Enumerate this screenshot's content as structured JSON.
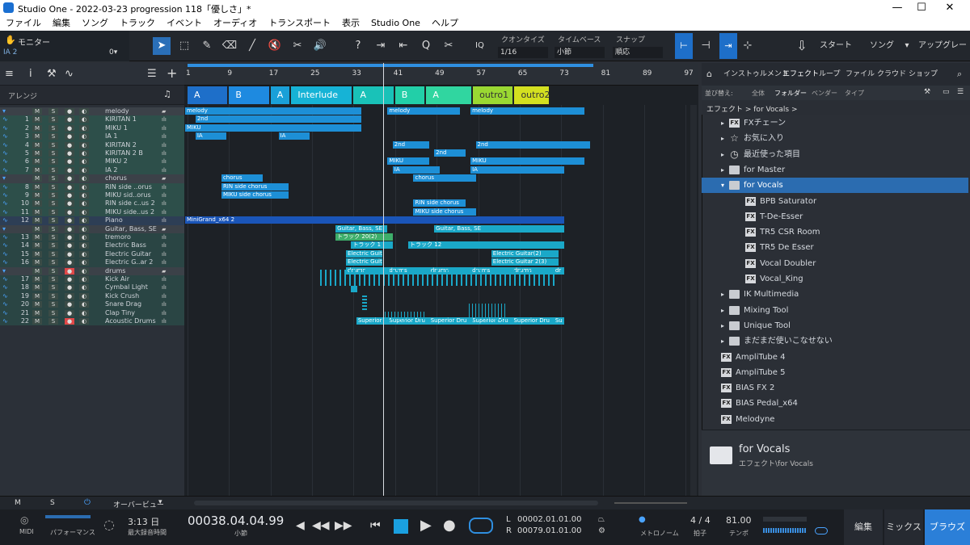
{
  "window": {
    "title": "Studio One - 2022-03-23 progression 118「優しさ」*"
  },
  "menu": [
    "ファイル",
    "編集",
    "ソング",
    "トラック",
    "イベント",
    "オーディオ",
    "トランスポート",
    "表示",
    "Studio One",
    "ヘルプ"
  ],
  "toolbar": {
    "monitor": "モニター",
    "track": "IA 2",
    "track_val": "0▾",
    "iq": "IQ",
    "quantize_label": "クオンタイズ",
    "quantize_val": "1/16",
    "timebase_label": "タイムベース",
    "timebase_val": "小節",
    "snap_label": "スナップ",
    "snap_val": "順応",
    "start": "スタート",
    "song": "ソング",
    "upgrade": "アップグレード"
  },
  "arrange_label": "アレンジ",
  "ruler": [
    "1",
    "9",
    "17",
    "25",
    "33",
    "41",
    "49",
    "57",
    "65",
    "73",
    "81",
    "89",
    "97"
  ],
  "sections": [
    {
      "label": "A",
      "c": "#1e6fc9"
    },
    {
      "label": "B",
      "c": "#1e8ae0"
    },
    {
      "label": "A",
      "c": "#1aa0d8"
    },
    {
      "label": "Interlude",
      "c": "#16b3d6"
    },
    {
      "label": "A",
      "c": "#19c2b8"
    },
    {
      "label": "B",
      "c": "#22cfa8"
    },
    {
      "label": "A",
      "c": "#30d6a0"
    },
    {
      "label": "outro1",
      "c": "#9ad832"
    },
    {
      "label": "outro2",
      "c": "#d4e020"
    }
  ],
  "tracks": [
    {
      "n": "",
      "name": "melody",
      "t": "folder"
    },
    {
      "n": "1",
      "name": "KIRITAN 1",
      "t": "ga"
    },
    {
      "n": "2",
      "name": "MIKU 1",
      "t": "ga"
    },
    {
      "n": "3",
      "name": "IA 1",
      "t": "ga"
    },
    {
      "n": "4",
      "name": "KIRITAN 2",
      "t": "ga"
    },
    {
      "n": "5",
      "name": "KIRITAN 2 B",
      "t": "ga"
    },
    {
      "n": "6",
      "name": "MIKU 2",
      "t": "ga"
    },
    {
      "n": "7",
      "name": "IA 2",
      "t": "ga"
    },
    {
      "n": "",
      "name": "chorus",
      "t": "folder"
    },
    {
      "n": "8",
      "name": "RIN side ..orus",
      "t": "ga"
    },
    {
      "n": "9",
      "name": "MIKU sid..orus",
      "t": "ga"
    },
    {
      "n": "10",
      "name": "RIN side c..us 2",
      "t": "ga"
    },
    {
      "n": "11",
      "name": "MIKU side..us 2",
      "t": "ga"
    },
    {
      "n": "12",
      "name": "Piano",
      "t": "sel"
    },
    {
      "n": "",
      "name": "Guitar, Bass, SE",
      "t": "folder"
    },
    {
      "n": "13",
      "name": "tremoro",
      "t": "gb"
    },
    {
      "n": "14",
      "name": "Electric Bass",
      "t": "gb"
    },
    {
      "n": "15",
      "name": "Electric Guitar",
      "t": "gb"
    },
    {
      "n": "16",
      "name": "Electric G..ar 2",
      "t": "gb"
    },
    {
      "n": "",
      "name": "drums",
      "t": "folder"
    },
    {
      "n": "17",
      "name": "Kick Air",
      "t": "gb"
    },
    {
      "n": "18",
      "name": "Cymbal Light",
      "t": "gb"
    },
    {
      "n": "19",
      "name": "Kick Crush",
      "t": "gb"
    },
    {
      "n": "20",
      "name": "Snare Drag",
      "t": "gb"
    },
    {
      "n": "21",
      "name": "Clap Tiny",
      "t": "gb"
    },
    {
      "n": "22",
      "name": "Acoustic Drums",
      "t": "gb"
    }
  ],
  "clips": [
    {
      "r": 0,
      "s": 1,
      "e": 35,
      "label": "melody",
      "c": "#1d8fd6"
    },
    {
      "r": 0,
      "s": 40,
      "e": 54,
      "label": "melody",
      "c": "#1d8fd6"
    },
    {
      "r": 0,
      "s": 56,
      "e": 78,
      "label": "melody",
      "c": "#1d8fd6"
    },
    {
      "r": 1,
      "s": 3,
      "e": 35,
      "label": "2nd",
      "c": "#1d8fd6"
    },
    {
      "r": 2,
      "s": 1,
      "e": 35,
      "label": "MIKU",
      "c": "#1d8fd6"
    },
    {
      "r": 3,
      "s": 3,
      "e": 9,
      "label": "IA",
      "c": "#1d8fd6"
    },
    {
      "r": 3,
      "s": 19,
      "e": 25,
      "label": "IA",
      "c": "#1d8fd6"
    },
    {
      "r": 4,
      "s": 41,
      "e": 48,
      "label": "2nd",
      "c": "#1d8fd6"
    },
    {
      "r": 4,
      "s": 57,
      "e": 79,
      "label": "2nd",
      "c": "#1d8fd6"
    },
    {
      "r": 5,
      "s": 49,
      "e": 55,
      "label": "2nd",
      "c": "#1d8fd6"
    },
    {
      "r": 6,
      "s": 40,
      "e": 48,
      "label": "MIKU",
      "c": "#1d8fd6"
    },
    {
      "r": 6,
      "s": 56,
      "e": 78,
      "label": "MIKU",
      "c": "#1d8fd6"
    },
    {
      "r": 7,
      "s": 41,
      "e": 50,
      "label": "IA",
      "c": "#1d8fd6"
    },
    {
      "r": 7,
      "s": 56,
      "e": 74,
      "label": "IA",
      "c": "#1d8fd6"
    },
    {
      "r": 8,
      "s": 8,
      "e": 16,
      "label": "chorus",
      "c": "#1d8fd6"
    },
    {
      "r": 8,
      "s": 45,
      "e": 57,
      "label": "chorus",
      "c": "#1d8fd6"
    },
    {
      "r": 9,
      "s": 8,
      "e": 21,
      "label": "RIN side chorus",
      "c": "#1d8fd6"
    },
    {
      "r": 10,
      "s": 8,
      "e": 21,
      "label": "MIKU side chorus",
      "c": "#1d8fd6"
    },
    {
      "r": 11,
      "s": 45,
      "e": 55,
      "label": "RIN side chorus",
      "c": "#1d8fd6"
    },
    {
      "r": 12,
      "s": 45,
      "e": 57,
      "label": "MIKU side chorus",
      "c": "#1d8fd6"
    },
    {
      "r": 13,
      "s": 1,
      "e": 74,
      "label": "MiniGrand_x64 2",
      "c": "#1a55b8"
    },
    {
      "r": 14,
      "s": 30,
      "e": 40,
      "label": "Guitar, Bass, SE",
      "c": "#1aa8c8"
    },
    {
      "r": 14,
      "s": 49,
      "e": 74,
      "label": "Guitar, Bass, SE",
      "c": "#1aa8c8"
    },
    {
      "r": 15,
      "s": 30,
      "e": 41,
      "label": "トラック 20(2)",
      "c": "#3dae6a"
    },
    {
      "r": 16,
      "s": 33,
      "e": 41,
      "label": "トラック 1",
      "c": "#1aa8c8"
    },
    {
      "r": 16,
      "s": 44,
      "e": 74,
      "label": "トラック 12",
      "c": "#1aa8c8"
    },
    {
      "r": 17,
      "s": 32,
      "e": 39,
      "label": "Electric Guitar",
      "c": "#1aa8c8"
    },
    {
      "r": 17,
      "s": 60,
      "e": 73,
      "label": "Electric Guitar(2)",
      "c": "#1aa8c8"
    },
    {
      "r": 18,
      "s": 32,
      "e": 39,
      "label": "Electric Guitar",
      "c": "#1aa8c8"
    },
    {
      "r": 18,
      "s": 60,
      "e": 73,
      "label": "Electric Guitar 2(3)",
      "c": "#1aa8c8"
    },
    {
      "r": 19,
      "s": 32,
      "e": 40,
      "label": "drums",
      "c": "#1aa8c8"
    },
    {
      "r": 19,
      "s": 40,
      "e": 48,
      "label": "drums",
      "c": "#1aa8c8"
    },
    {
      "r": 19,
      "s": 48,
      "e": 56,
      "label": "drums",
      "c": "#1aa8c8"
    },
    {
      "r": 19,
      "s": 56,
      "e": 64,
      "label": "drums",
      "c": "#1aa8c8"
    },
    {
      "r": 19,
      "s": 64,
      "e": 72,
      "label": "drums",
      "c": "#1aa8c8"
    },
    {
      "r": 19,
      "s": 72,
      "e": 74,
      "label": "dr",
      "c": "#1aa8c8"
    },
    {
      "r": 25,
      "s": 34,
      "e": 40,
      "label": "Superior",
      "c": "#1aa8c8"
    },
    {
      "r": 25,
      "s": 40,
      "e": 48,
      "label": "Superior Dru",
      "c": "#1aa8c8"
    },
    {
      "r": 25,
      "s": 48,
      "e": 56,
      "label": "Superior Dru",
      "c": "#1aa8c8"
    },
    {
      "r": 25,
      "s": 56,
      "e": 64,
      "label": "Superior Dru",
      "c": "#1aa8c8"
    },
    {
      "r": 25,
      "s": 64,
      "e": 72,
      "label": "Superior Dru",
      "c": "#1aa8c8"
    },
    {
      "r": 25,
      "s": 72,
      "e": 74,
      "label": "Su",
      "c": "#1aa8c8"
    }
  ],
  "browser": {
    "tabs": [
      "インストゥルメント",
      "エフェクト",
      "ループ",
      "ファイル",
      "クラウド",
      "ショップ"
    ],
    "sort_label": "並び替え:",
    "sort_opts": [
      "全体",
      "フォルダー",
      "ベンダー",
      "タイプ"
    ],
    "path": "エフェクト > for Vocals >",
    "items": [
      {
        "label": "FXチェーン",
        "ind": 1,
        "ic": "fx",
        "arrow": "▸"
      },
      {
        "label": "お気に入り",
        "ind": 1,
        "ic": "star",
        "arrow": "▸"
      },
      {
        "label": "最近使った項目",
        "ind": 1,
        "ic": "clock",
        "arrow": "▸"
      },
      {
        "label": "for Master",
        "ind": 1,
        "ic": "folder",
        "arrow": "▸"
      },
      {
        "label": "for Vocals",
        "ind": 1,
        "ic": "folder",
        "arrow": "▾",
        "sel": true
      },
      {
        "label": "BPB Saturator",
        "ind": 2,
        "ic": "fx"
      },
      {
        "label": "T-De-Esser",
        "ind": 2,
        "ic": "fx"
      },
      {
        "label": "TR5 CSR Room",
        "ind": 2,
        "ic": "fx"
      },
      {
        "label": "TR5 De Esser",
        "ind": 2,
        "ic": "fx"
      },
      {
        "label": "Vocal Doubler",
        "ind": 2,
        "ic": "fx"
      },
      {
        "label": "Vocal_King",
        "ind": 2,
        "ic": "fx"
      },
      {
        "label": "IK Multimedia",
        "ind": 1,
        "ic": "folder",
        "arrow": "▸"
      },
      {
        "label": "Mixing Tool",
        "ind": 1,
        "ic": "folder",
        "arrow": "▸"
      },
      {
        "label": "Unique Tool",
        "ind": 1,
        "ic": "folder",
        "arrow": "▸"
      },
      {
        "label": "まだまだ使いこなせない",
        "ind": 1,
        "ic": "folder",
        "arrow": "▸"
      },
      {
        "label": "AmpliTube 4",
        "ind": 0,
        "ic": "fx"
      },
      {
        "label": "AmpliTube 5",
        "ind": 0,
        "ic": "fx"
      },
      {
        "label": "BIAS FX 2",
        "ind": 0,
        "ic": "fx"
      },
      {
        "label": "BIAS Pedal_x64",
        "ind": 0,
        "ic": "fx"
      },
      {
        "label": "Melodyne",
        "ind": 0,
        "ic": "fx"
      }
    ],
    "info_title": "for Vocals",
    "info_path": "エフェクト\\for Vocals"
  },
  "statusbar": {
    "m": "M",
    "s": "S",
    "overview": "オーバービュー"
  },
  "transport": {
    "midi": "MIDI",
    "perf": "パフォーマンス",
    "rec_time": "3:13 日",
    "rec_label": "最大録音時間",
    "position": "00038.04.04.99",
    "pos_unit": "小節",
    "l": "L",
    "r": "R",
    "l_val": "00002.01.01.00",
    "r_val": "00079.01.01.00",
    "metronome": "メトロノーム",
    "sig": "4 / 4",
    "sig_label": "拍子",
    "tempo": "81.00",
    "tempo_label": "テンポ",
    "edit": "編集",
    "mix": "ミックス",
    "browse": "ブラウズ"
  }
}
